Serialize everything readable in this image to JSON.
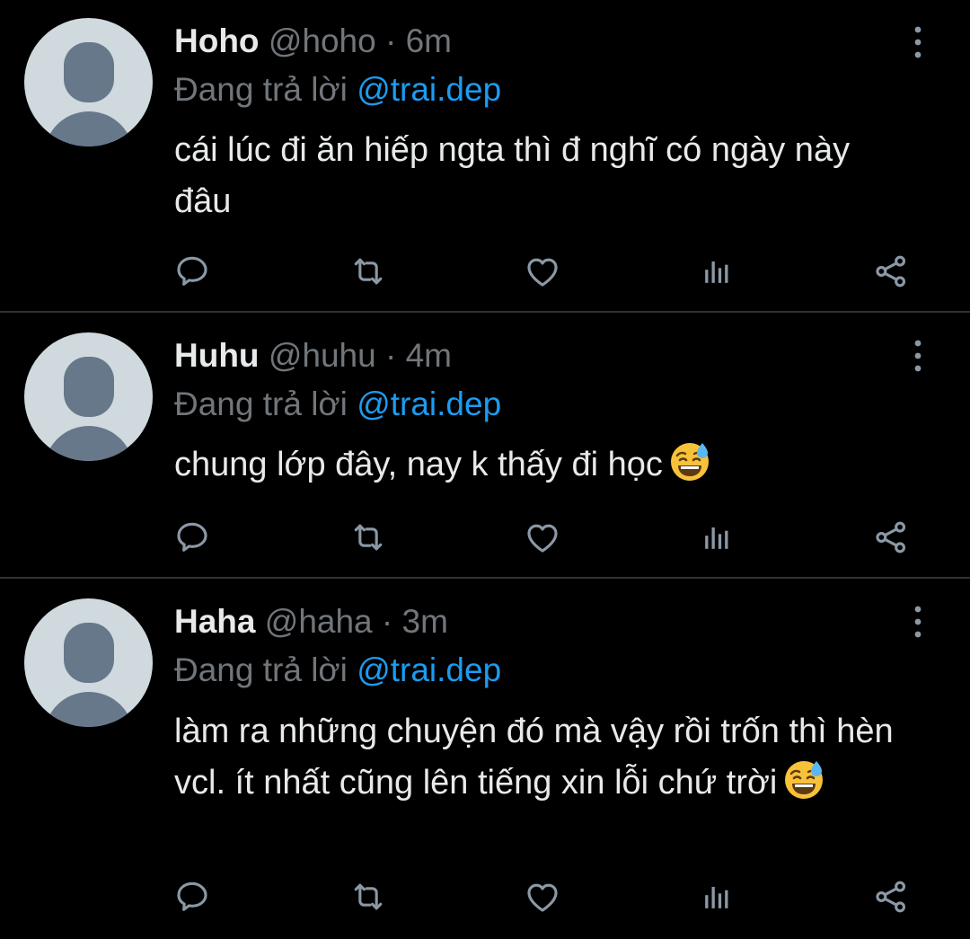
{
  "icons": {
    "avatar": "default-avatar-icon",
    "more": "more-vertical-icon",
    "reply": "reply-icon",
    "retweet": "retweet-icon",
    "like": "heart-icon",
    "views": "analytics-icon",
    "share": "share-icon",
    "emoji": "grinning-face-with-sweat-emoji"
  },
  "colors": {
    "background": "#000000",
    "text": "#e7e9ea",
    "muted": "#71767b",
    "link": "#1d9bf0",
    "divider": "#2f3336"
  },
  "replies": [
    {
      "name": "Hoho",
      "handle": "@hoho",
      "sep": "·",
      "time": "6m",
      "replying_label": "Đang trả lời",
      "replying_to": "@trai.dep",
      "text": "cái lúc đi ăn hiếp ngta thì đ nghĩ có ngày này đâu"
    },
    {
      "name": "Huhu",
      "handle": "@huhu",
      "sep": "·",
      "time": "4m",
      "replying_label": "Đang trả lời",
      "replying_to": "@trai.dep",
      "text": "chung lớp đây, nay k thấy đi học"
    },
    {
      "name": "Haha",
      "handle": "@haha",
      "sep": "·",
      "time": "3m",
      "replying_label": "Đang trả lời",
      "replying_to": "@trai.dep",
      "text": "làm ra những chuyện đó mà vậy rồi trốn thì hèn vcl. ít nhất cũng lên tiếng xin lỗi chứ trời"
    }
  ]
}
